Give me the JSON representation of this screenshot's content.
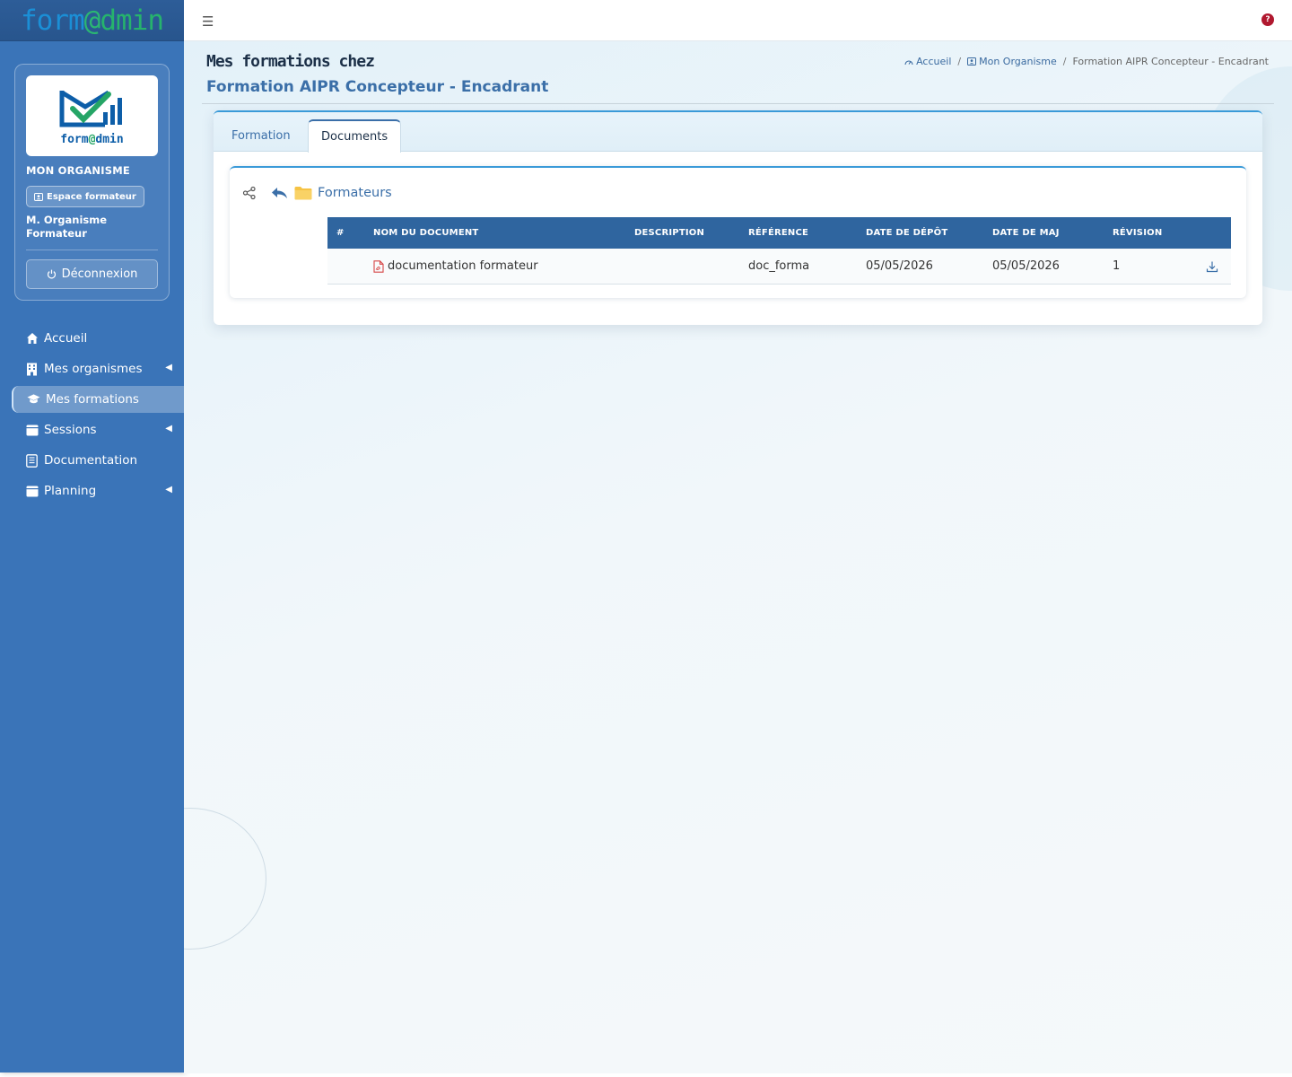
{
  "brand": {
    "name_part1": "form",
    "at": "@",
    "name_part2": "dmin"
  },
  "profile": {
    "logo_word_1": "form",
    "logo_at": "@",
    "logo_word_2": "dmin",
    "org_name": "MON ORGANISME",
    "space_label": "Espace formateur",
    "user_name": "M. Organisme Formateur",
    "logout_label": "Déconnexion"
  },
  "nav": {
    "items": [
      {
        "label": "Accueil",
        "icon": "home-icon"
      },
      {
        "label": "Mes organismes",
        "icon": "building-icon"
      },
      {
        "label": "Mes formations",
        "icon": "graduation-icon"
      },
      {
        "label": "Sessions",
        "icon": "calendar-icon"
      },
      {
        "label": "Documentation",
        "icon": "document-icon"
      },
      {
        "label": "Planning",
        "icon": "calendar-icon"
      }
    ]
  },
  "topbar": {
    "help": "?"
  },
  "page": {
    "title": "Mes formations chez",
    "subtitle": "Formation AIPR Concepteur - Encadrant"
  },
  "breadcrumb": {
    "home": "Accueil",
    "org": "Mon Organisme",
    "current": "Formation AIPR Concepteur - Encadrant"
  },
  "tabs": {
    "formation": "Formation",
    "documents": "Documents"
  },
  "folder": {
    "name": "Formateurs"
  },
  "table": {
    "headers": [
      "#",
      "NOM DU DOCUMENT",
      "DESCRIPTION",
      "RÉFÉRENCE",
      "DATE DE DÉPÔT",
      "DATE DE MAJ",
      "RÉVISION"
    ],
    "rows": [
      {
        "num": "",
        "name": "documentation formateur",
        "description": "",
        "reference": "doc_forma",
        "date_depot": "05/05/2026",
        "date_maj": "05/05/2026",
        "revision": "1"
      }
    ]
  },
  "colors": {
    "sidebar": "#3a74b8",
    "accent": "#3a9ad8",
    "table_header": "#2f659f",
    "help": "#b0182f"
  }
}
